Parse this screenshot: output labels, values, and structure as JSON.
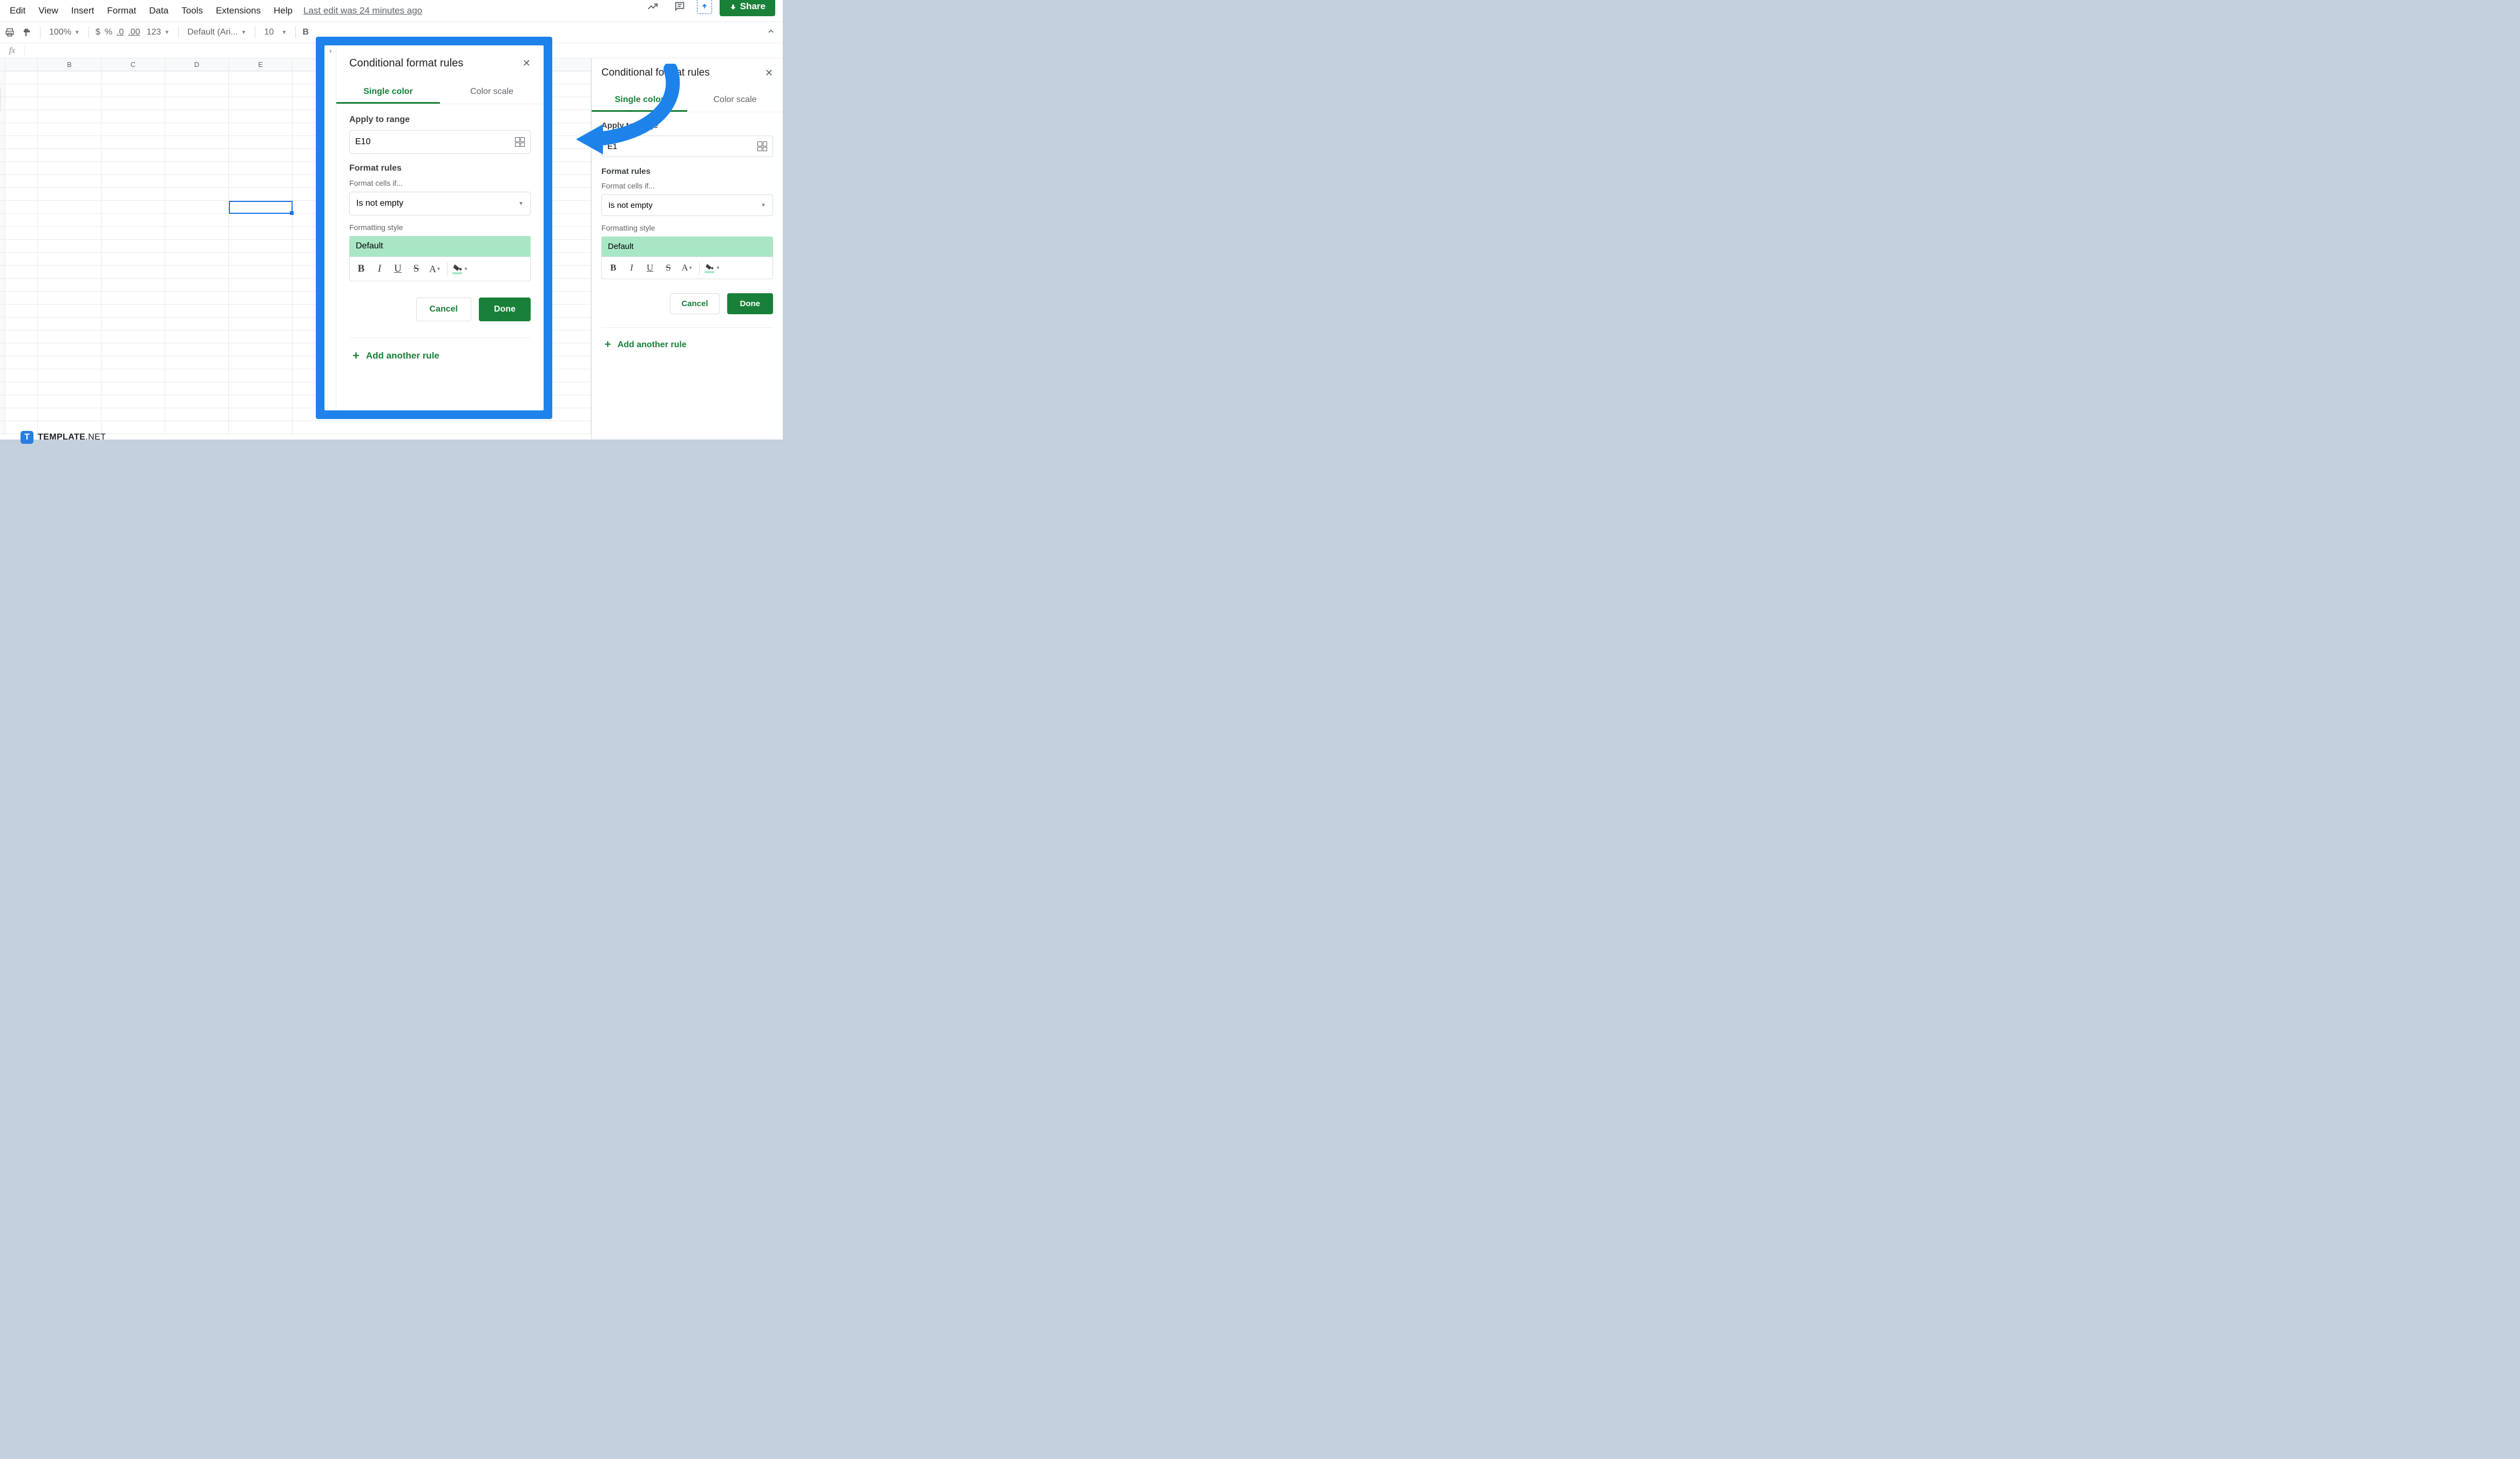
{
  "menu": {
    "items": [
      "Edit",
      "View",
      "Insert",
      "Format",
      "Data",
      "Tools",
      "Extensions",
      "Help"
    ],
    "last_edit": "Last edit was 24 minutes ago",
    "share": "Share"
  },
  "toolbar": {
    "zoom": "100%",
    "currency": "$",
    "percent": "%",
    "dec_dec": ".0",
    "inc_dec": ".00",
    "number_format": "123",
    "font": "Default (Ari...",
    "font_size": "10",
    "bold": "B"
  },
  "formula_bar": {
    "fx": "fx"
  },
  "grid": {
    "columns": [
      "B",
      "C",
      "D",
      "E"
    ],
    "selected_cell": "E10"
  },
  "side_panel": {
    "title": "Conditional format rules",
    "tabs": {
      "single": "Single color",
      "scale": "Color scale"
    },
    "apply_label": "Apply to range",
    "range_value": "E1",
    "rules_label": "Format rules",
    "cells_if_label": "Format cells if...",
    "condition": "Is not empty",
    "style_label": "Formatting style",
    "style_preview": "Default",
    "cancel": "Cancel",
    "done": "Done",
    "add_rule": "Add another rule"
  },
  "popup": {
    "title": "Conditional format rules",
    "tabs": {
      "single": "Single color",
      "scale": "Color scale"
    },
    "apply_label": "Apply to range",
    "range_value": "E10",
    "rules_label": "Format rules",
    "cells_if_label": "Format cells if...",
    "condition": "Is not empty",
    "style_label": "Formatting style",
    "style_preview": "Default",
    "cancel": "Cancel",
    "done": "Done",
    "add_rule": "Add another rule"
  },
  "brand": {
    "t": "T",
    "name": "TEMPLATE",
    "suffix": ".NET"
  }
}
